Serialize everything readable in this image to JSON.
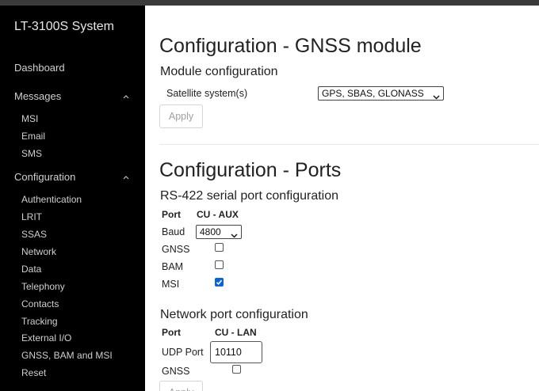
{
  "sidebar": {
    "title": "LT-3100S System",
    "dashboard": "Dashboard",
    "messages": {
      "label": "Messages",
      "items": [
        "MSI",
        "Email",
        "SMS"
      ]
    },
    "configuration": {
      "label": "Configuration",
      "items": [
        "Authentication",
        "LRIT",
        "SSAS",
        "Network",
        "Data",
        "Telephony",
        "Contacts",
        "Tracking",
        "External I/O",
        "GNSS, BAM and MSI",
        "Reset"
      ]
    }
  },
  "gnss": {
    "title": "Configuration - GNSS module",
    "section": "Module configuration",
    "satellite_label": "Satellite system(s)",
    "satellite_value": "GPS, SBAS, GLONASS",
    "apply": "Apply"
  },
  "ports": {
    "title": "Configuration - Ports",
    "serial": {
      "title": "RS-422 serial port configuration",
      "port_col": "Port",
      "value_col": "CU - AUX",
      "baud_label": "Baud",
      "baud_value": "4800",
      "gnss_label": "GNSS",
      "gnss_checked": false,
      "bam_label": "BAM",
      "bam_checked": false,
      "msi_label": "MSI",
      "msi_checked": true
    },
    "network": {
      "title": "Network port configuration",
      "port_col": "Port",
      "value_col": "CU - LAN",
      "udp_label": "UDP Port",
      "udp_value": "10110",
      "gnss_label": "GNSS",
      "gnss_checked": false,
      "apply": "Apply"
    }
  }
}
